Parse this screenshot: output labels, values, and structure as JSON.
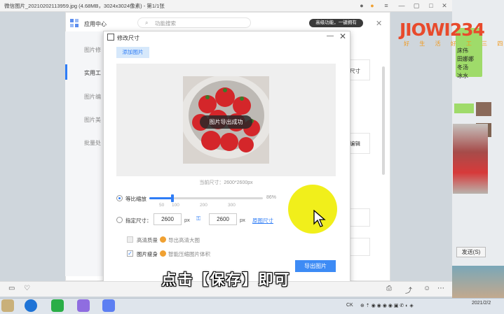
{
  "viewer": {
    "title": "微信图片_20210202113959.jpg (4.68MB，3024x3024像素) - 第1/1张"
  },
  "logo": {
    "text": "JIOWI234",
    "sub": "好 生 活 好 工 三 四"
  },
  "chat": {
    "lines": [
      "床伟",
      "田娜娜",
      "冬汤",
      "冰水"
    ],
    "send_label": "发送(S)"
  },
  "app_center": {
    "title": "应用中心",
    "search_placeholder": "功能搜索",
    "pro_badge": "高级功能，一键拥有",
    "side_items": [
      "图片修",
      "实用工",
      "图片编",
      "图片美",
      "批量处"
    ],
    "card_labels": [
      "尺寸",
      "编辑"
    ]
  },
  "dialog": {
    "title": "修改尺寸",
    "add_image": "添加图片",
    "toast": "图片导出成功",
    "current_size": "当前尺寸：2600*2600px",
    "proportional_label": "等比缩放",
    "slider_percent": "86%",
    "slider_value": 0.86,
    "ticks": [
      "50",
      "100",
      "200",
      "300"
    ],
    "specify_label": "指定尺寸：",
    "width_value": "2600",
    "height_value": "2600",
    "unit": "px",
    "original_size": "原图尺寸",
    "hq_label": "高清质量",
    "hq_hint": "导出高清大图",
    "slim_label": "图片瘦身",
    "slim_hint": "智能压缩图片体积",
    "export_button": "导出图片"
  },
  "caption": "点击【保存】即可",
  "taskbar": {
    "tray_text": "CK",
    "date": "2021/2/2"
  },
  "colors": {
    "accent": "#2f7df6",
    "highlight": "#f1ef1b",
    "export_button": "#3d8bf5"
  }
}
